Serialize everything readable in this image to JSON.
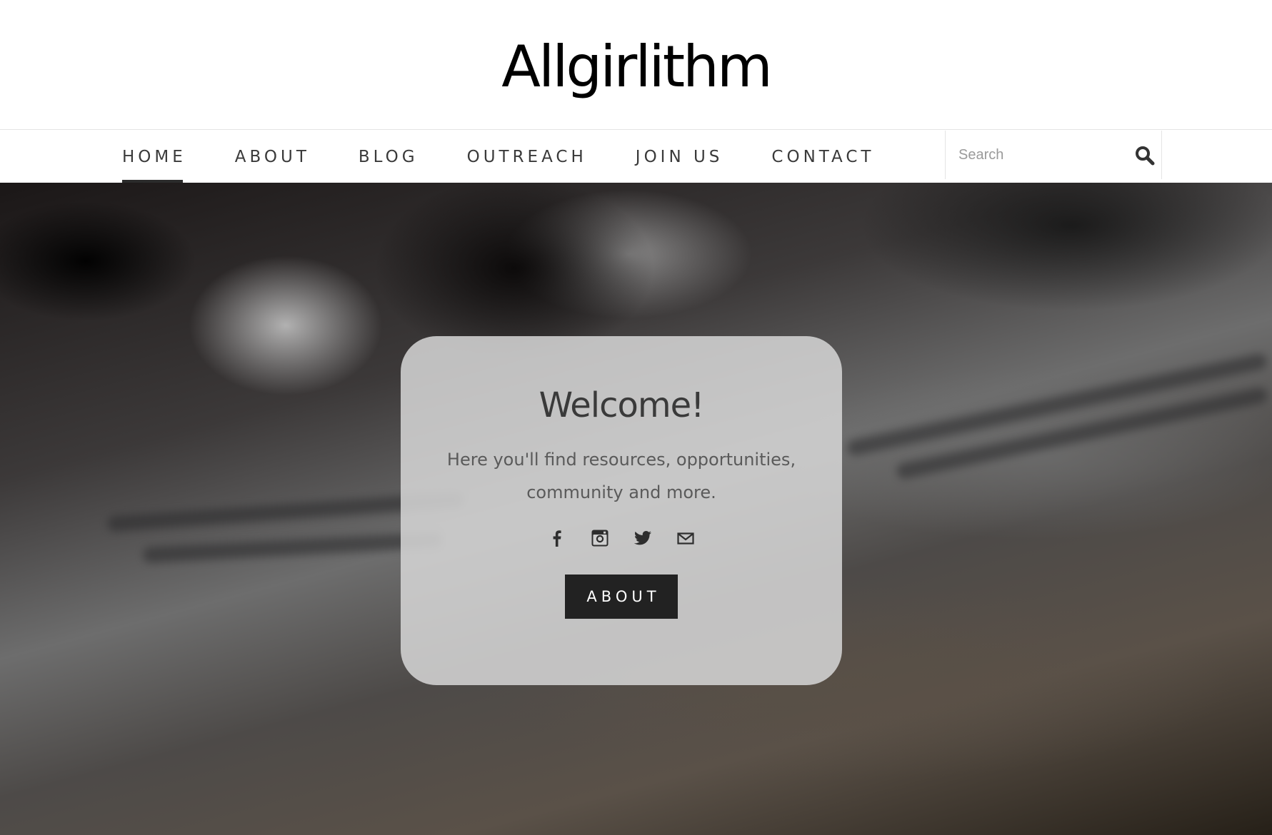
{
  "header": {
    "site_title": "Allgirlithm"
  },
  "nav": {
    "items": [
      {
        "label": "HOME",
        "active": true
      },
      {
        "label": "ABOUT",
        "active": false
      },
      {
        "label": "BLOG",
        "active": false
      },
      {
        "label": "OUTREACH",
        "active": false
      },
      {
        "label": "JOIN US",
        "active": false
      },
      {
        "label": "CONTACT",
        "active": false
      }
    ]
  },
  "search": {
    "placeholder": "Search",
    "value": "",
    "icon": "search-icon"
  },
  "hero": {
    "welcome_title": "Welcome!",
    "welcome_text": "Here you'll find resources, opportunities, community and more.",
    "social_icons": [
      "facebook-icon",
      "instagram-icon",
      "twitter-icon",
      "email-icon"
    ],
    "button_label": "ABOUT"
  },
  "colors": {
    "button_bg": "#222222",
    "card_bg": "#d6d6d6",
    "nav_text": "#3a3a3a",
    "active_underline": "#2b2b2b"
  }
}
